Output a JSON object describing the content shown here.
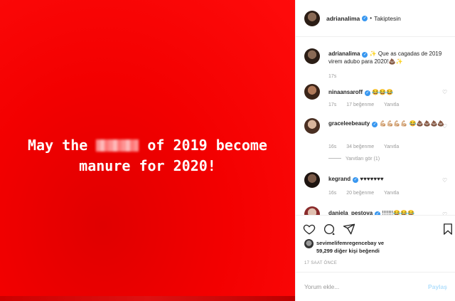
{
  "media": {
    "line1_pre": "May the ",
    "line1_post": " of 2019 become",
    "line2": "manure for 2020!",
    "background_color": "#f30000"
  },
  "header": {
    "username": "adrianalima",
    "dot": "•",
    "follow_label": "Takiptesin"
  },
  "caption": {
    "username": "adrianalima",
    "text": "✨ Que as cagadas de 2019 virem adubo para 2020!💩✨",
    "time": "17s"
  },
  "comments": [
    {
      "username": "ninaansaroff",
      "text": "😂😂😂",
      "time": "17s",
      "likes": "17 beğenme",
      "reply": "Yanıtla"
    },
    {
      "username": "graceleebeauty",
      "text": "💪🏼💪🏼💪🏼💪🏼 😂💩💩💩💩",
      "time": "16s",
      "likes": "34 beğenme",
      "reply": "Yanıtla",
      "view_replies": "Yanıtları gör (1)"
    },
    {
      "username": "kegrand",
      "text": "♥♥♥♥♥♥♥",
      "time": "16s",
      "likes": "20 beğenme",
      "reply": "Yanıtla"
    },
    {
      "username": "daniela_pestova",
      "text": "!!!!!!!😂😂😂"
    }
  ],
  "likes": {
    "line1": "sevimelifemregencebay ve",
    "line2": "59,299 diğer kişi beğendi"
  },
  "timestamp": "17 SAAT ÖNCE",
  "comment_box": {
    "placeholder": "Yorum ekle...",
    "post_label": "Paylaş"
  },
  "icons": [
    "heart-icon",
    "comment-icon",
    "share-icon",
    "bookmark-icon",
    "verified-icon"
  ],
  "colors": {
    "verified": "#3897f0",
    "post_button": "#b2dffc"
  }
}
